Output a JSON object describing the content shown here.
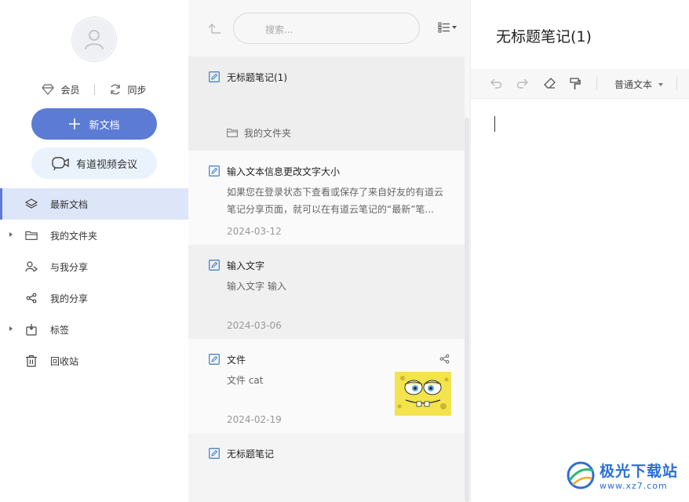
{
  "sidebar": {
    "member_label": "会员",
    "sync_label": "同步",
    "new_doc_label": "新文档",
    "meeting_label": "有道视频会议",
    "nav": [
      {
        "label": "最新文档",
        "icon": "layers-icon",
        "active": true,
        "expandable": false
      },
      {
        "label": "我的文件夹",
        "icon": "folder-icon",
        "active": false,
        "expandable": true
      },
      {
        "label": "与我分享",
        "icon": "shared-with-me-icon",
        "active": false,
        "expandable": false
      },
      {
        "label": "我的分享",
        "icon": "share-icon",
        "active": false,
        "expandable": false
      },
      {
        "label": "标签",
        "icon": "tag-icon",
        "active": false,
        "expandable": true
      },
      {
        "label": "回收站",
        "icon": "trash-icon",
        "active": false,
        "expandable": false
      }
    ]
  },
  "list": {
    "search_placeholder": "搜索...",
    "notes": [
      {
        "title": "无标题笔记(1)",
        "folder": "我的文件夹",
        "selected": true
      },
      {
        "title": "输入文本信息更改文字大小",
        "body": "如果您在登录状态下查看或保存了来自好友的有道云笔记分享页面，就可以在有道云笔记的“最新”笔...",
        "date": "2024-03-12"
      },
      {
        "title": "输入文字",
        "body": "输入文字 输入",
        "date": "2024-03-06"
      },
      {
        "title": "文件",
        "body": "文件 cat",
        "date": "2024-02-19"
      },
      {
        "title": "无标题笔记"
      }
    ]
  },
  "editor": {
    "title": "无标题笔记(1)",
    "format_label": "普通文本"
  },
  "watermark": {
    "brand": "极光下载站",
    "url": "www.xz7.com"
  },
  "colors": {
    "accent": "#5b7bd5",
    "active_bg": "#dde6f8",
    "meeting_bg": "#eaf3fb",
    "note_icon": "#4a86c7"
  }
}
